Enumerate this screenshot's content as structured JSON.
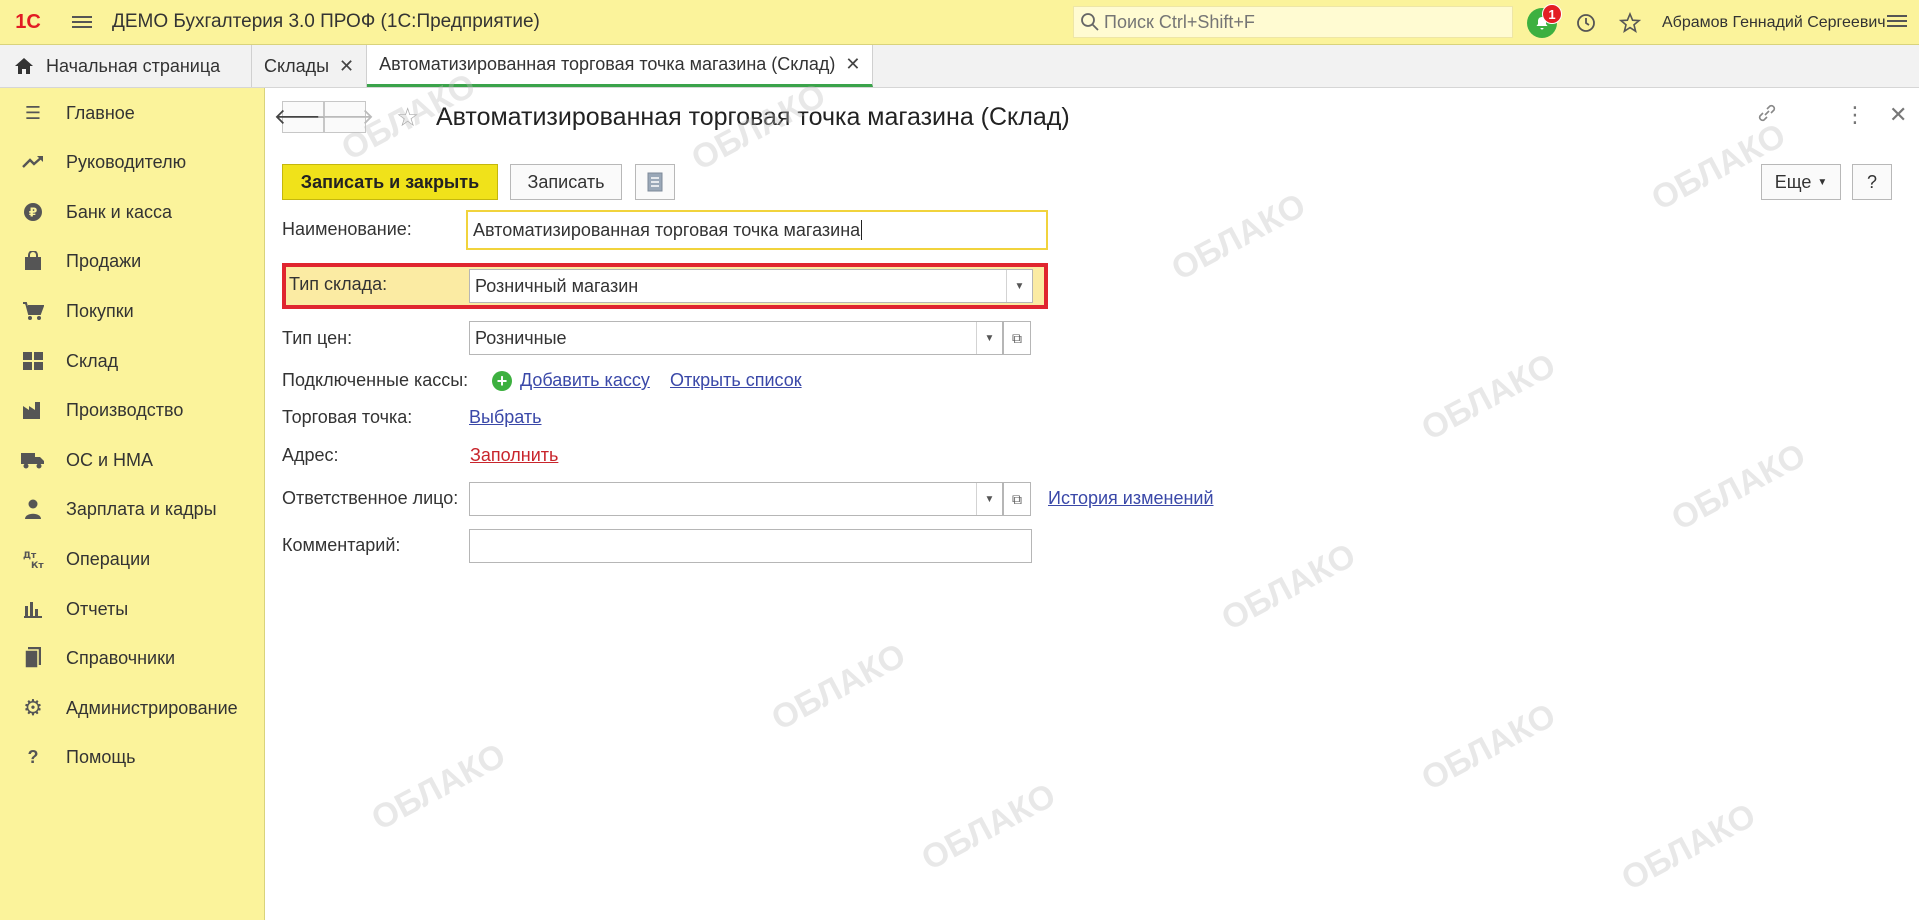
{
  "topbar": {
    "logo": "1С",
    "app_title": "ДЕМО Бухгалтерия 3.0 ПРОФ  (1С:Предприятие)",
    "search_placeholder": "Поиск Ctrl+Shift+F",
    "notification_count": "1",
    "user_name": "Абрамов Геннадий Сергеевич"
  },
  "tabs": [
    {
      "label": "Начальная страница"
    },
    {
      "label": "Склады"
    },
    {
      "label": "Автоматизированная торговая точка магазина (Склад)"
    }
  ],
  "sidebar": {
    "items": [
      {
        "label": "Главное",
        "icon": "menu-lines-icon"
      },
      {
        "label": "Руководителю",
        "icon": "trend-icon"
      },
      {
        "label": "Банк и касса",
        "icon": "ruble-coin-icon"
      },
      {
        "label": "Продажи",
        "icon": "shopping-bag-icon"
      },
      {
        "label": "Покупки",
        "icon": "cart-icon"
      },
      {
        "label": "Склад",
        "icon": "warehouse-grid-icon"
      },
      {
        "label": "Производство",
        "icon": "factory-icon"
      },
      {
        "label": "ОС и НМА",
        "icon": "truck-icon"
      },
      {
        "label": "Зарплата и кадры",
        "icon": "person-icon"
      },
      {
        "label": "Операции",
        "icon": "dt-kt-icon"
      },
      {
        "label": "Отчеты",
        "icon": "bar-chart-icon"
      },
      {
        "label": "Справочники",
        "icon": "book-icon"
      },
      {
        "label": "Администрирование",
        "icon": "gear-icon"
      },
      {
        "label": "Помощь",
        "icon": "question-icon"
      }
    ]
  },
  "form": {
    "title": "Автоматизированная торговая точка магазина (Склад)",
    "save_close_label": "Записать и закрыть",
    "save_label": "Записать",
    "more_label": "Еще",
    "help_label": "?",
    "name_label": "Наименование:",
    "name_value": "Автоматизированная торговая точка магазина",
    "warehouse_type_label": "Тип склада:",
    "warehouse_type_value": "Розничный магазин",
    "price_type_label": "Тип цен:",
    "price_type_value": "Розничные",
    "cash_registers_label": "Подключенные кассы:",
    "add_register_link": "Добавить кассу",
    "open_list_link": "Открыть список",
    "trade_point_label": "Торговая точка:",
    "trade_point_link": "Выбрать",
    "address_label": "Адрес:",
    "address_link": "Заполнить",
    "responsible_label": "Ответственное лицо:",
    "responsible_value": "",
    "history_link": "История изменений",
    "comment_label": "Комментарий:",
    "comment_value": ""
  },
  "watermark": {
    "text": "ОБЛАКО"
  },
  "colors": {
    "sidebar_bg": "#fbf39b",
    "primary_button": "#f0e21a",
    "highlight_border": "#e0252f",
    "link": "#3a48a8",
    "link_red": "#c8252c",
    "notification_green": "#3db040"
  }
}
